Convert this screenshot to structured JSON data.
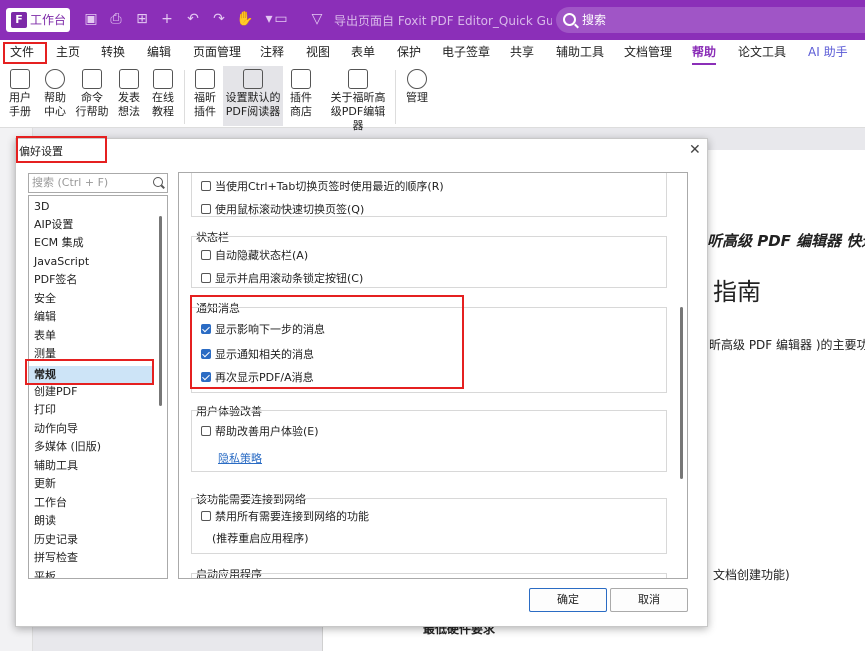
{
  "titlebar": {
    "workbench_label": "工作台",
    "document_title": "导出页面自 Foxit PDF Editor_Quick Guide.pdf ...",
    "search_placeholder": "搜索"
  },
  "menu": {
    "items": [
      "文件",
      "主页",
      "转换",
      "编辑",
      "页面管理",
      "注释",
      "视图",
      "表单",
      "保护",
      "电子签章",
      "共享",
      "辅助工具",
      "文档管理",
      "帮助",
      "论文工具",
      "AI 助手"
    ],
    "active": "帮助"
  },
  "ribbon": {
    "buttons": [
      {
        "line1": "用户",
        "line2": "手册"
      },
      {
        "line1": "帮助",
        "line2": "中心"
      },
      {
        "line1": "命令",
        "line2": "行帮助"
      },
      {
        "line1": "发表",
        "line2": "想法"
      },
      {
        "line1": "在线",
        "line2": "教程"
      },
      {
        "line1": "福昕",
        "line2": "插件"
      },
      {
        "line1": "设置默认的",
        "line2": "PDF阅读器"
      },
      {
        "line1": "插件",
        "line2": "商店"
      },
      {
        "line1": "关于福昕高",
        "line2": "级PDF编辑器"
      },
      {
        "line1": "管理",
        "line2": ""
      }
    ]
  },
  "background_doc": {
    "heading1": "听高级 PDF 编辑器 快速指南",
    "heading2": "指南",
    "body1": "昕高级 PDF 编辑器 )的主要功能",
    "body2": "文档创建功能)",
    "footer": "最低硬件要求"
  },
  "dialog": {
    "title": "偏好设置",
    "search_placeholder": "搜索 (Ctrl + F)",
    "categories": [
      "3D",
      "AIP设置",
      "ECM 集成",
      "JavaScript",
      "PDF签名",
      "安全",
      "编辑",
      "表单",
      "测量",
      "常规",
      "创建PDF",
      "打印",
      "动作向导",
      "多媒体 (旧版)",
      "辅助工具",
      "更新",
      "工作台",
      "朗读",
      "历史记录",
      "拼写检查",
      "平板"
    ],
    "selected_category": "常规",
    "tab_group": {
      "options": [
        {
          "label": "当使用Ctrl+Tab切换页签时使用最近的顺序(R)",
          "checked": false
        },
        {
          "label": "使用鼠标滚动快速切换页签(Q)",
          "checked": false
        }
      ]
    },
    "status_bar": {
      "title": "状态栏",
      "options": [
        {
          "label": "自动隐藏状态栏(A)",
          "checked": false
        },
        {
          "label": "显示并启用滚动条锁定按钮(C)",
          "checked": false
        }
      ]
    },
    "notifications": {
      "title": "通知消息",
      "options": [
        {
          "label": "显示影响下一步的消息",
          "checked": true
        },
        {
          "label": "显示通知相关的消息",
          "checked": true
        },
        {
          "label": "再次显示PDF/A消息",
          "checked": true
        }
      ]
    },
    "ux": {
      "title": "用户体验改善",
      "option": {
        "label": "帮助改善用户体验(E)",
        "checked": false
      },
      "privacy_link": "隐私策略"
    },
    "network": {
      "title": "该功能需要连接到网络",
      "option": {
        "label": "禁用所有需要连接到网络的功能",
        "checked": false
      },
      "note": "(推荐重启应用程序)"
    },
    "startup": {
      "title": "启动应用程序"
    },
    "ok_label": "确定",
    "cancel_label": "取消"
  }
}
